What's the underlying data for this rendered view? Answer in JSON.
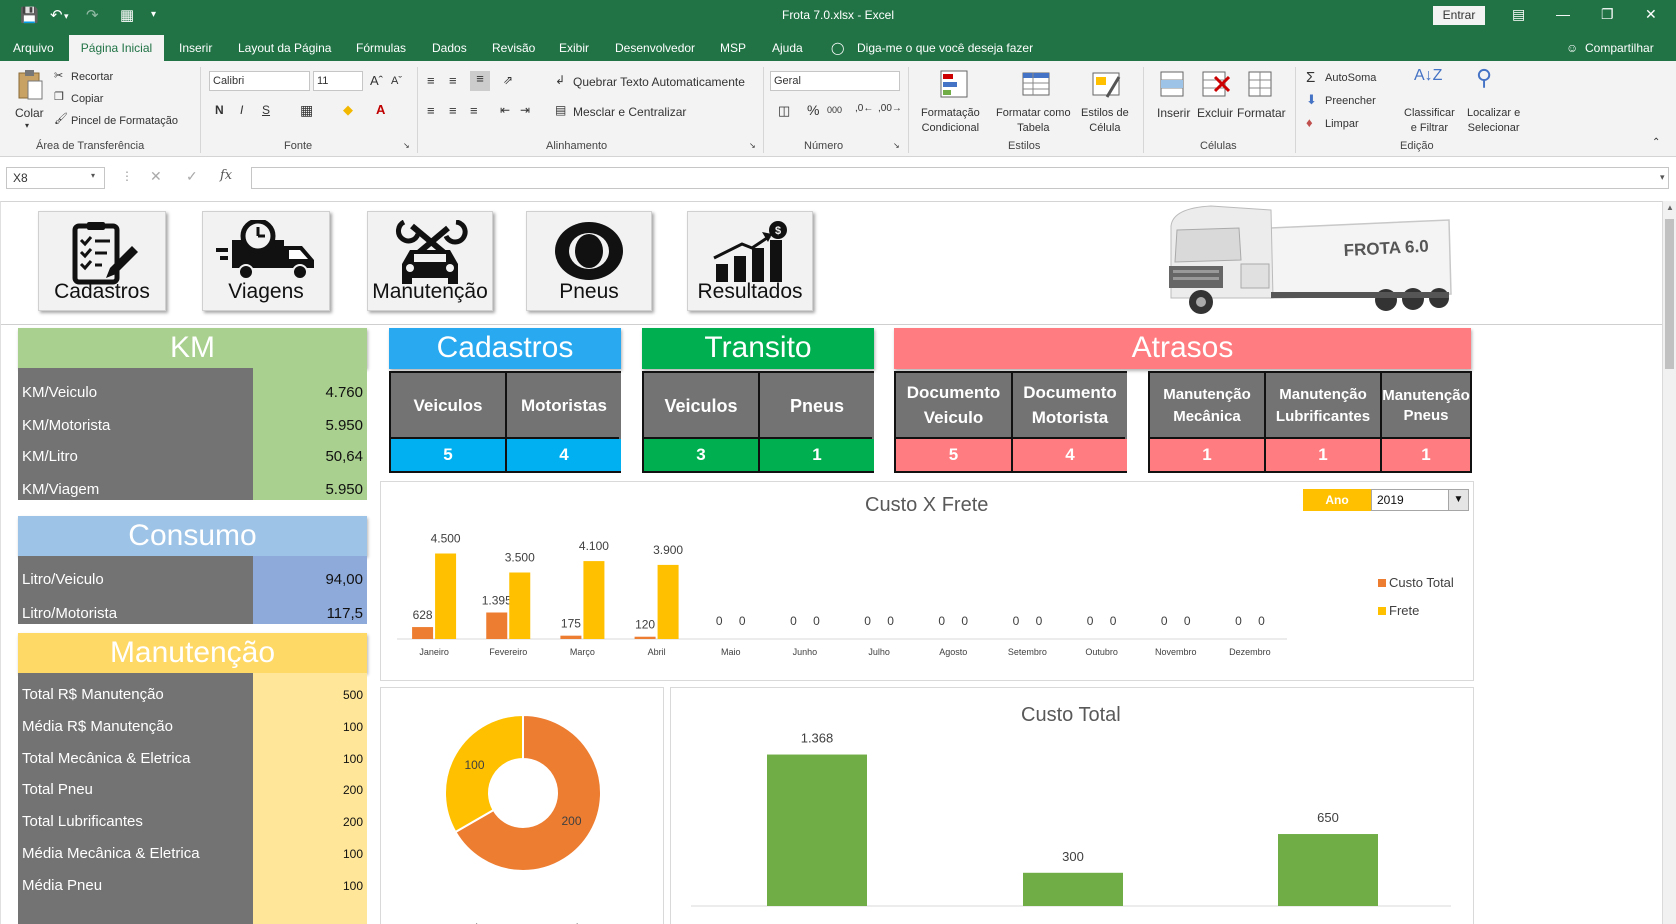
{
  "window": {
    "title": "Frota 7.0.xlsx  -  Excel",
    "sign_in": "Entrar"
  },
  "menu": [
    "Arquivo",
    "Página Inicial",
    "Inserir",
    "Layout da Página",
    "Fórmulas",
    "Dados",
    "Revisão",
    "Exibir",
    "Desenvolvedor",
    "MSP",
    "Ajuda"
  ],
  "menu_extra": {
    "tell_me": "Diga-me o que você deseja fazer",
    "share": "Compartilhar"
  },
  "ribbon": {
    "groups": [
      "Área de Transferência",
      "Fonte",
      "Alinhamento",
      "Número",
      "Estilos",
      "Células",
      "Edição"
    ],
    "clipboard": {
      "paste": "Colar",
      "cut": "Recortar",
      "copy": "Copiar",
      "painter": "Pincel de Formatação"
    },
    "font": {
      "name": "Calibri",
      "size": "11",
      "bold": "N",
      "italic": "I",
      "underline": "S"
    },
    "alignment": {
      "wrap": "Quebrar Texto Automaticamente",
      "merge": "Mesclar e Centralizar"
    },
    "number": {
      "format": "Geral",
      "percent": "%",
      "thousands": "000"
    },
    "styles": {
      "conditional": "Formatação\nCondicional",
      "table": "Formatar como\nTabela",
      "cell": "Estilos de\nCélula"
    },
    "cells": {
      "insert": "Inserir",
      "delete": "Excluir",
      "format": "Formatar"
    },
    "editing": {
      "autosum": "AutoSoma",
      "fill": "Preencher",
      "clear": "Limpar",
      "sort": "Classificar\ne Filtrar",
      "find": "Localizar e\nSelecionar"
    }
  },
  "formula_bar": {
    "cell": "X8"
  },
  "nav": [
    "Cadastros",
    "Viagens",
    "Manutenção",
    "Pneus",
    "Resultados"
  ],
  "brand": {
    "logo_text": "FROTA 6.0"
  },
  "km": {
    "title": "KM",
    "rows": [
      {
        "label": "KM/Veiculo",
        "value": "4.760"
      },
      {
        "label": "KM/Motorista",
        "value": "5.950"
      },
      {
        "label": "KM/Litro",
        "value": "50,64"
      },
      {
        "label": "KM/Viagem",
        "value": "5.950"
      }
    ]
  },
  "consumo": {
    "title": "Consumo",
    "rows": [
      {
        "label": "Litro/Veiculo",
        "value": "94,00"
      },
      {
        "label": "Litro/Motorista",
        "value": "117,5"
      }
    ]
  },
  "manutencao": {
    "title": "Manutenção",
    "rows": [
      {
        "label": "Total R$ Manutenção",
        "value": "500"
      },
      {
        "label": "Média R$ Manutenção",
        "value": "100"
      },
      {
        "label": "Total Mecânica & Eletrica",
        "value": "100"
      },
      {
        "label": "Total Pneu",
        "value": "200"
      },
      {
        "label": "Total Lubrificantes",
        "value": "200"
      },
      {
        "label": "Média Mecânica & Eletrica",
        "value": "100"
      },
      {
        "label": "Média  Pneu",
        "value": "100"
      }
    ]
  },
  "cadastros": {
    "title": "Cadastros",
    "cols": [
      {
        "label": "Veiculos",
        "value": "5"
      },
      {
        "label": "Motoristas",
        "value": "4"
      }
    ]
  },
  "transito": {
    "title": "Transito",
    "cols": [
      {
        "label": "Veiculos",
        "value": "3"
      },
      {
        "label": "Pneus",
        "value": "1"
      }
    ]
  },
  "atrasos": {
    "title": "Atrasos",
    "cols": [
      {
        "label": "Documento Veiculo",
        "value": "5"
      },
      {
        "label": "Documento Motorista",
        "value": "4"
      },
      {
        "label": "Manutenção Mecânica",
        "value": "1"
      },
      {
        "label": "Manutenção Lubrificantes",
        "value": "1"
      },
      {
        "label": "Manutenção Pneus",
        "value": "1"
      }
    ]
  },
  "filters": {
    "year_label": "Ano",
    "year": "2019"
  },
  "colors": {
    "custo": "#ed7d31",
    "frete": "#ffc000",
    "green": "#70ad47"
  },
  "chart_data": [
    {
      "type": "bar",
      "title": "Custo X Frete",
      "categories": [
        "Janeiro",
        "Fevereiro",
        "Março",
        "Abril",
        "Maio",
        "Junho",
        "Julho",
        "Agosto",
        "Setembro",
        "Outubro",
        "Novembro",
        "Dezembro"
      ],
      "series": [
        {
          "name": "Custo Total",
          "values": [
            628,
            1395,
            175,
            120,
            0,
            0,
            0,
            0,
            0,
            0,
            0,
            0
          ],
          "labels": [
            "628",
            "1.395",
            "175",
            "120",
            "0",
            "0",
            "0",
            "0",
            "0",
            "0",
            "0",
            "0"
          ]
        },
        {
          "name": "Frete",
          "values": [
            4500,
            3500,
            4100,
            3900,
            0,
            0,
            0,
            0,
            0,
            0,
            0,
            0
          ],
          "labels": [
            "4.500",
            "3.500",
            "4.100",
            "3.900",
            "0",
            "0",
            "0",
            "0",
            "0",
            "0",
            "0",
            "0"
          ]
        }
      ],
      "legend": "right"
    },
    {
      "type": "pie",
      "title": "",
      "categories": [
        "Corretiva",
        "Preventiva"
      ],
      "values": [
        200,
        100
      ],
      "labels": [
        "200",
        "100"
      ]
    },
    {
      "type": "bar",
      "title": "Custo Total",
      "values": [
        1368,
        300,
        650
      ],
      "labels": [
        "1.368",
        "300",
        "650"
      ]
    }
  ]
}
